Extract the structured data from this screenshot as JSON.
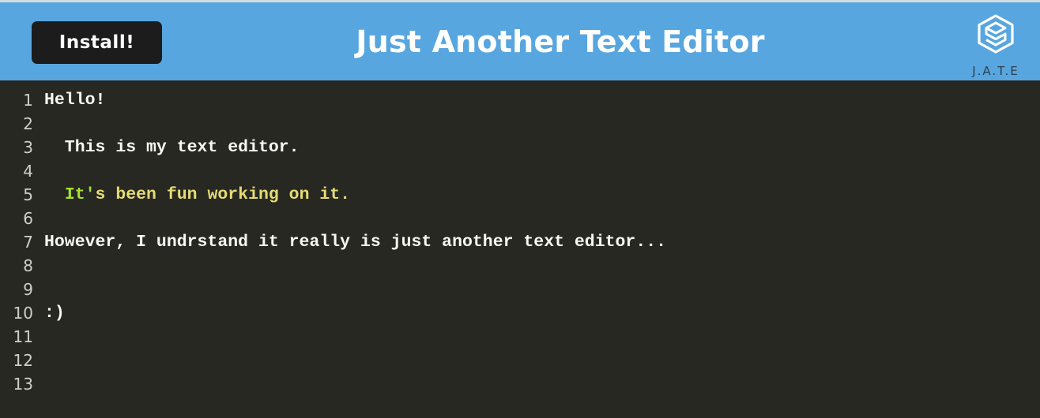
{
  "navbar": {
    "install_label": "Install!",
    "title": "Just Another Text Editor",
    "logo_text": "J.A.T.E",
    "logo_icon": "hexagon-s-logo-icon"
  },
  "colors": {
    "navbar_bg": "#58a6df",
    "editor_bg": "#272822",
    "install_bg": "#1c1c1c",
    "text": "#f8f8f2",
    "string_green": "#a6e22e",
    "string_yellow": "#e6db74"
  },
  "editor": {
    "lines": [
      {
        "number": "1",
        "text": "Hello!"
      },
      {
        "number": "2",
        "text": ""
      },
      {
        "number": "3",
        "text": "  This is my text editor."
      },
      {
        "number": "4",
        "text": ""
      },
      {
        "number": "5",
        "prefix": "  ",
        "token_green": "It'",
        "token_yellow": "s been fun working on it."
      },
      {
        "number": "6",
        "text": ""
      },
      {
        "number": "7",
        "text": "However, I undrstand it really is just another text editor..."
      },
      {
        "number": "8",
        "text": ""
      },
      {
        "number": "9",
        "text": ""
      },
      {
        "number": "10",
        "text": ":)"
      },
      {
        "number": "11",
        "text": ""
      },
      {
        "number": "12",
        "text": ""
      },
      {
        "number": "13",
        "text": ""
      }
    ]
  }
}
